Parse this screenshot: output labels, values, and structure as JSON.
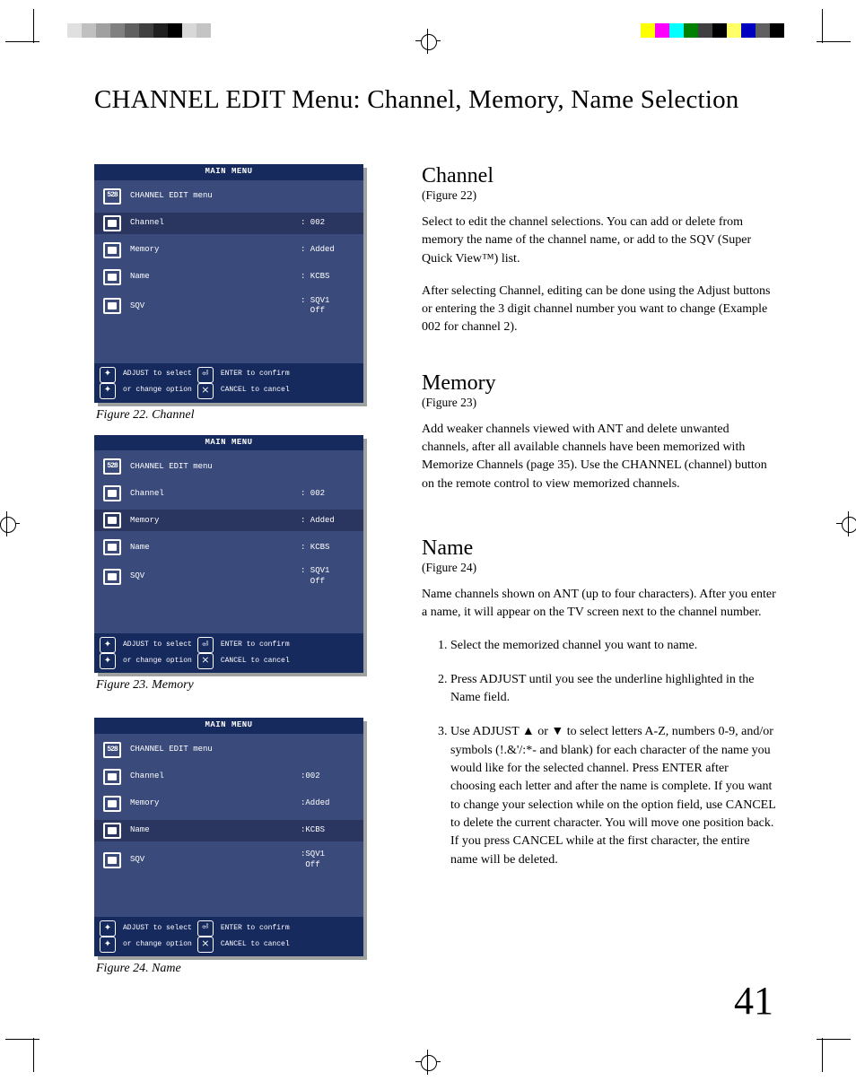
{
  "page_title": "CHANNEL EDIT Menu: Channel, Memory, Name Selection",
  "page_number": "41",
  "colorbars": {
    "left": [
      "#e0e0e0",
      "#c0c0c0",
      "#a0a0a0",
      "#808080",
      "#606060",
      "#404040",
      "#202020",
      "#000000",
      "#d8d8d8",
      "#c4c4c4"
    ],
    "right": [
      "#ffff00",
      "#ff00ff",
      "#00ffff",
      "#008000",
      "#404040",
      "#000000",
      "#ffff66",
      "#0000c0",
      "#606060",
      "#000000"
    ]
  },
  "osd_common": {
    "title": "MAIN MENU",
    "subhead": "CHANNEL EDIT menu",
    "rows": [
      {
        "key": "channel",
        "label": "Channel",
        "value": ": 002"
      },
      {
        "key": "memory",
        "label": "Memory",
        "value": ": Added"
      },
      {
        "key": "name",
        "label": "Name",
        "value": ": KCBS"
      },
      {
        "key": "sqv",
        "label": "SQV",
        "value": ": SQV1\n  Off"
      }
    ],
    "hints": {
      "adjust": "ADJUST to select",
      "enter": "ENTER to confirm",
      "change": "or change option",
      "cancel": "CANCEL to cancel"
    }
  },
  "figures": {
    "f22": {
      "selected": "channel",
      "caption": "Figure 22.  Channel"
    },
    "f23": {
      "selected": "memory",
      "caption": "Figure 23.  Memory"
    },
    "f24": {
      "selected": "name",
      "caption": "Figure 24.  Name",
      "row_overrides": {
        "channel": ":002",
        "memory": ":Added",
        "name": ":KCBS",
        "sqv": ":SQV1\n Off"
      }
    }
  },
  "sections": {
    "channel": {
      "heading": "Channel",
      "figref": "(Figure 22)",
      "paras": [
        "Select to edit the channel selections.  You can add or delete from memory the name of the channel name, or add to the SQV (Super Quick View™) list.",
        "After selecting Channel, editing can be done using the Adjust buttons or entering the 3 digit channel number you want to change (Example 002 for channel 2)."
      ]
    },
    "memory": {
      "heading": "Memory",
      "figref": "(Figure 23)",
      "paras": [
        "Add weaker channels viewed with ANT and delete unwanted channels, after all available channels have been memorized with Memorize Channels (page 35).  Use the CHANNEL (channel) button on the remote control to view memorized channels."
      ]
    },
    "name": {
      "heading": "Name",
      "figref": "(Figure 24)",
      "paras": [
        "Name channels shown on ANT (up to four characters).  After you enter a name, it will appear on the TV screen next to the channel number."
      ],
      "steps": [
        "Select the memorized channel you want to name.",
        "Press ADJUST until you see the underline highlighted in the Name field.",
        "Use ADJUST ▲ or ▼ to select letters A-Z, numbers 0-9, and/or symbols (!.&'/:*- and blank) for each character of the name you would like for the selected channel.  Press ENTER after choosing each letter and after the name is complete. If you want to change your selection while on the option field, use CANCEL to delete the current character.  You will move one position back.  If you press CANCEL while at the first character, the entire name will be deleted."
      ]
    }
  }
}
